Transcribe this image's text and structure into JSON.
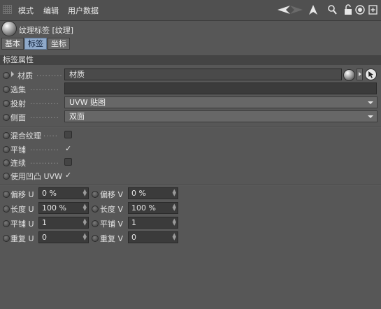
{
  "menubar": {
    "items": [
      "模式",
      "编辑",
      "用户数据"
    ],
    "icons": [
      "back-arrow-icon",
      "forward-arrow-icon",
      "cursor-up-icon",
      "search-icon",
      "lock-icon",
      "target-icon",
      "new-panel-icon"
    ]
  },
  "header": {
    "title": "纹理标签 [纹理]",
    "tabs": [
      {
        "label": "基本",
        "active": false
      },
      {
        "label": "标签",
        "active": true
      },
      {
        "label": "坐标",
        "active": false
      }
    ]
  },
  "section": {
    "title": "标签属性"
  },
  "fields": {
    "material": {
      "label": "材质",
      "value": "材质"
    },
    "selection": {
      "label": "选集",
      "value": ""
    },
    "projection": {
      "label": "投射",
      "value": "UVW 贴图"
    },
    "side": {
      "label": "侧面",
      "value": "双面"
    }
  },
  "checks": {
    "mix": {
      "label": "混合纹理",
      "checked": false
    },
    "tile": {
      "label": "平铺",
      "checked": true
    },
    "seamless": {
      "label": "连续",
      "checked": false
    },
    "bump": {
      "label": "使用凹凸 UVW",
      "checked": true
    }
  },
  "numeric": {
    "offset_u": {
      "label": "偏移 U",
      "value": "0 %"
    },
    "offset_v": {
      "label": "偏移 V",
      "value": "0 %"
    },
    "length_u": {
      "label": "长度 U",
      "value": "100 %"
    },
    "length_v": {
      "label": "长度 V",
      "value": "100 %"
    },
    "tiles_u": {
      "label": "平铺 U",
      "value": "1"
    },
    "tiles_v": {
      "label": "平铺 V",
      "value": "1"
    },
    "repeat_u": {
      "label": "重复 U",
      "value": "0"
    },
    "repeat_v": {
      "label": "重复 V",
      "value": "0"
    }
  },
  "glyphs": {
    "check": "✓",
    "spin": "▲▼"
  },
  "colors": {
    "active_tab": "#8fa9c9",
    "background": "#575757"
  }
}
